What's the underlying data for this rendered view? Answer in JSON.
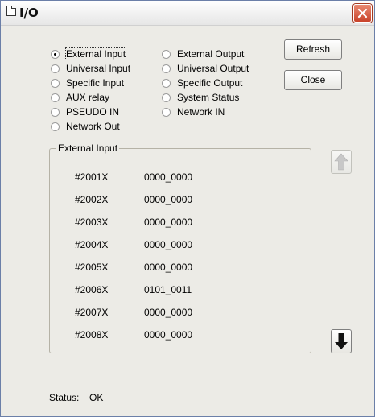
{
  "window": {
    "title": "I/O"
  },
  "radios": [
    {
      "label": "External Input",
      "selected": true
    },
    {
      "label": "Universal Input",
      "selected": false
    },
    {
      "label": "Specific Input",
      "selected": false
    },
    {
      "label": "AUX relay",
      "selected": false
    },
    {
      "label": "PSEUDO IN",
      "selected": false
    },
    {
      "label": "Network Out",
      "selected": false
    },
    {
      "label": "External Output",
      "selected": false
    },
    {
      "label": "Universal Output",
      "selected": false
    },
    {
      "label": "Specific Output",
      "selected": false
    },
    {
      "label": "System Status",
      "selected": false
    },
    {
      "label": "Network IN",
      "selected": false
    }
  ],
  "buttons": {
    "refresh": "Refresh",
    "close": "Close"
  },
  "group": {
    "title": "External Input",
    "rows": [
      {
        "name": "#2001X",
        "value": "0000_0000"
      },
      {
        "name": "#2002X",
        "value": "0000_0000"
      },
      {
        "name": "#2003X",
        "value": "0000_0000"
      },
      {
        "name": "#2004X",
        "value": "0000_0000"
      },
      {
        "name": "#2005X",
        "value": "0000_0000"
      },
      {
        "name": "#2006X",
        "value": "0101_0011"
      },
      {
        "name": "#2007X",
        "value": "0000_0000"
      },
      {
        "name": "#2008X",
        "value": "0000_0000"
      }
    ]
  },
  "scroll": {
    "up_icon": "up-arrow-icon",
    "down_icon": "down-arrow-icon"
  },
  "status": {
    "label": "Status:",
    "value": "OK"
  },
  "colors": {
    "close_button": "#c9432a",
    "window_bg": "#ecebe6",
    "group_border": "#b5b2a6"
  }
}
